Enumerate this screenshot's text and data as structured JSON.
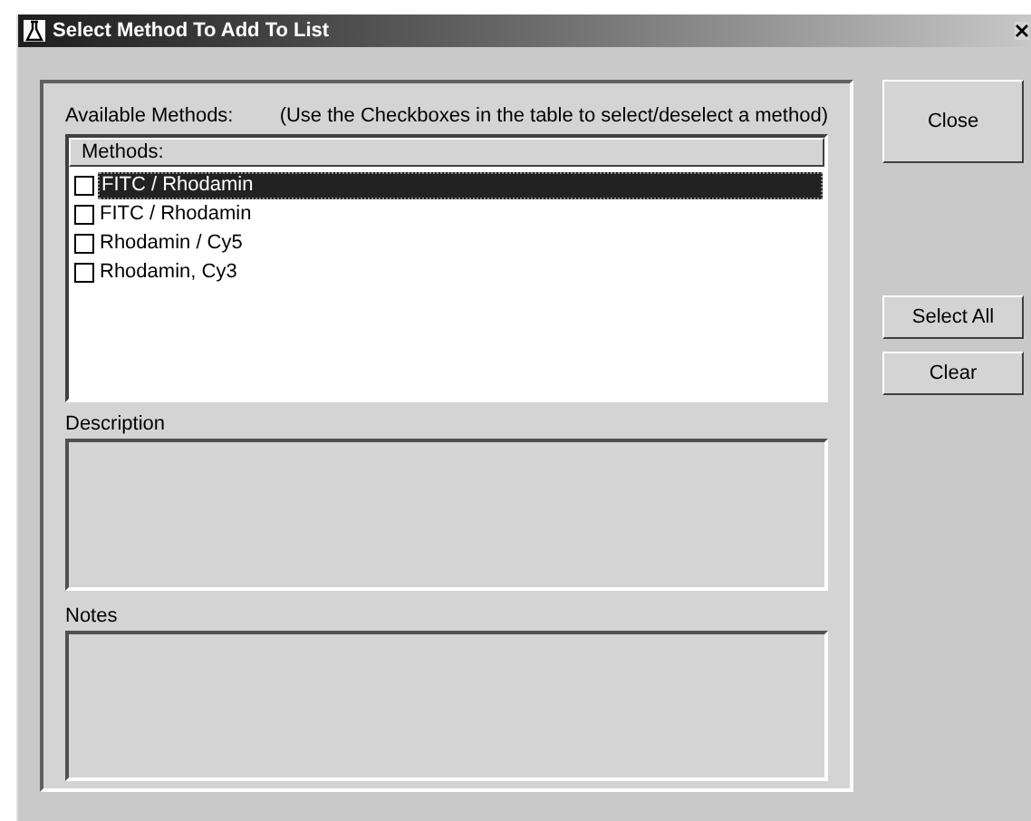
{
  "window": {
    "title": "Select Method To Add To List"
  },
  "available_label": "Available Methods:",
  "hint": "(Use the Checkboxes in the table to select/deselect a method)",
  "table": {
    "columns": [
      "Methods:"
    ],
    "rows": [
      {
        "name": "FITC / Rhodamin",
        "checked": false,
        "selected": true
      },
      {
        "name": "FITC / Rhodamin",
        "checked": false,
        "selected": false
      },
      {
        "name": "Rhodamin / Cy5",
        "checked": false,
        "selected": false
      },
      {
        "name": "Rhodamin, Cy3",
        "checked": false,
        "selected": false
      }
    ]
  },
  "description": {
    "label": "Description"
  },
  "notes": {
    "label": "Notes"
  },
  "buttons": {
    "close": "Close",
    "select_all": "Select All",
    "clear": "Clear"
  }
}
